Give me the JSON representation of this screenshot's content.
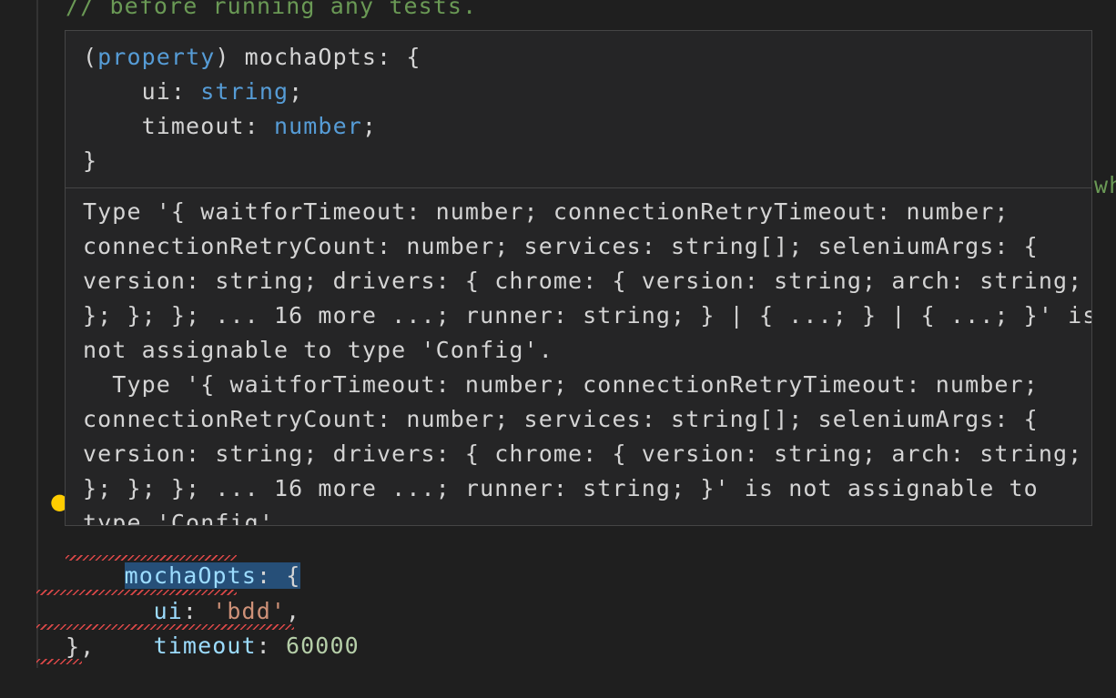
{
  "editor": {
    "comment_line": "// before running any tests.",
    "edge_text": "who",
    "code": {
      "prop_name": "mochaOpts",
      "colon_brace": ": {",
      "ui_key": "ui",
      "ui_colon": ": ",
      "ui_value": "'bdd'",
      "ui_comma": ",",
      "timeout_key": "timeout",
      "timeout_colon": ": ",
      "timeout_value": "60000",
      "closing": "},"
    },
    "lightbulb_icon": "lightbulb-icon"
  },
  "hover": {
    "signature": {
      "open_paren": "(",
      "keyword": "property",
      "rest_line1": ") mochaOpts: {",
      "ui_line_key": "    ui: ",
      "ui_line_type": "string",
      "ui_line_end": ";",
      "timeout_line_key": "    timeout: ",
      "timeout_line_type": "number",
      "timeout_line_end": ";",
      "close": "}"
    },
    "diagnostic": "Type '{ waitforTimeout: number; connectionRetryTimeout: number;\nconnectionRetryCount: number; services: string[]; seleniumArgs: {\nversion: string; drivers: { chrome: { version: string; arch: string;\n}; }; }; ... 16 more ...; runner: string; } | { ...; } | { ...; }' is\nnot assignable to type 'Config'.\n  Type '{ waitforTimeout: number; connectionRetryTimeout: number;\nconnectionRetryCount: number; services: string[]; seleniumArgs: {\nversion: string; drivers: { chrome: { version: string; arch: string;\n}; }; }; ... 16 more ...; runner: string; }' is not assignable to\ntype 'Config'."
  },
  "colors": {
    "background": "#1f1f1f",
    "hover_background": "#252526",
    "error_squiggle": "#f14c4c",
    "selection": "#264f78"
  }
}
